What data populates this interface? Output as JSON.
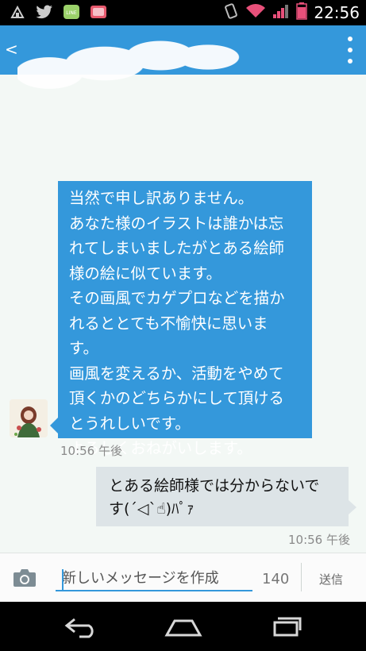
{
  "status_bar": {
    "time": "22:56",
    "icons": [
      "recycle-notification-icon",
      "twitter-icon",
      "line-icon",
      "app-notification-icon",
      "vibrate-icon",
      "wifi-icon",
      "signal-icon",
      "battery-icon"
    ]
  },
  "action_bar": {
    "back_label": "<",
    "title_hidden": true,
    "colors": {
      "background": "#3498db",
      "foreground": "#ffffff"
    }
  },
  "messages": {
    "incoming": {
      "lines": [
        "当然で申し訳ありません。",
        "あなた様のイラストは誰かは忘",
        "れてしまいましたがとある絵師",
        "様の絵に似ています。",
        "その画風でカゲプロなどを描か",
        "れるととても不愉快に思いま",
        "す。",
        "画風を変えるか、活動をやめて",
        "頂くかのどちらかにして頂ける",
        "とうれしいです。",
        "よろしくおねがいします。"
      ],
      "time": "10:56 午後",
      "color": "#3498db"
    },
    "outgoing": {
      "lines": [
        "とある絵師様では分からないで",
        "す(´◁`☝)ﾊﾟｧ"
      ],
      "time": "10:56 午後",
      "color": "#dde4e7"
    }
  },
  "composer": {
    "placeholder": "新しいメッセージを作成",
    "char_count": "140",
    "send_label": "送信"
  },
  "nav_bar": {
    "buttons": [
      "back-icon",
      "home-icon",
      "recents-icon"
    ]
  }
}
